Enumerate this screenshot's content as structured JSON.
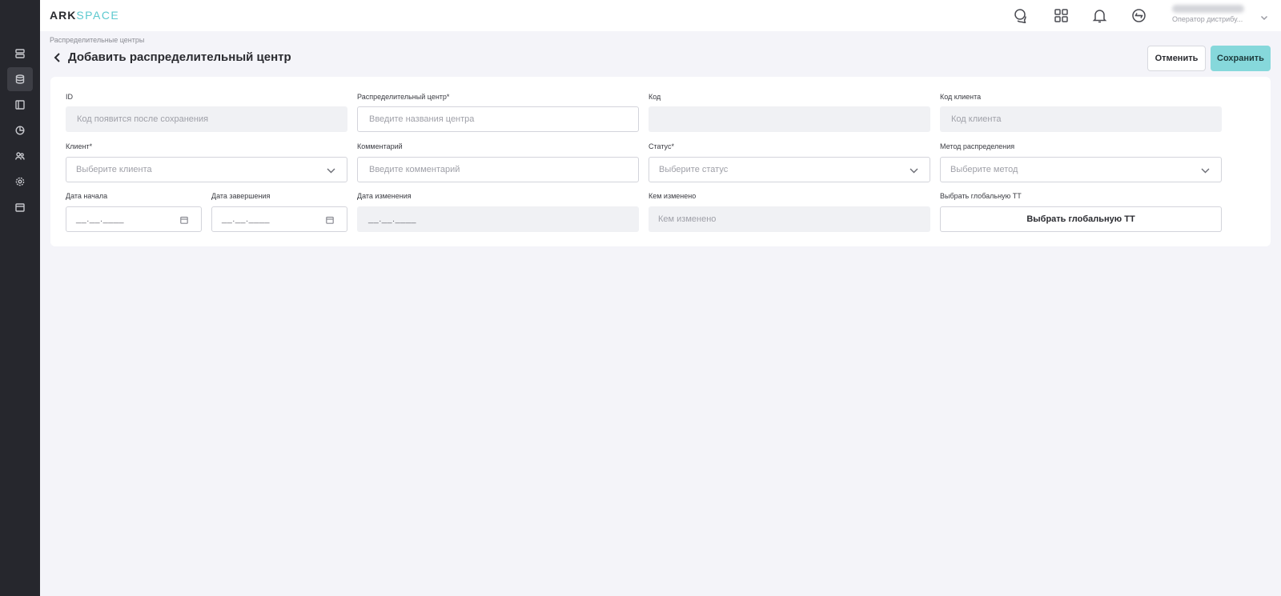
{
  "app": {
    "logo_ark": "ARK",
    "logo_space": "SPACE"
  },
  "sidebar": {
    "items": [
      {
        "icon": "server-icon",
        "active": false
      },
      {
        "icon": "database-icon",
        "active": true
      },
      {
        "icon": "layout-icon",
        "active": false
      },
      {
        "icon": "pie-chart-icon",
        "active": false
      },
      {
        "icon": "users-icon",
        "active": false
      },
      {
        "icon": "settings-icon",
        "active": false
      },
      {
        "icon": "calendar-icon",
        "active": false
      }
    ]
  },
  "header": {
    "icons": [
      "chat-icon",
      "apps-grid-icon",
      "bell-icon",
      "sync-icon"
    ],
    "user_role": "Оператор дистрибу..."
  },
  "page": {
    "breadcrumb": "Распределительные центры",
    "title": "Добавить распределительный центр",
    "cancel_label": "Отменить",
    "save_label": "Сохранить"
  },
  "form": {
    "id": {
      "label": "ID",
      "placeholder": "Код появится после сохранения"
    },
    "center": {
      "label": "Распределительный центр*",
      "placeholder": "Введите названия центра"
    },
    "code": {
      "label": "Код",
      "placeholder": ""
    },
    "client_code": {
      "label": "Код клиента",
      "placeholder": "Код клиента"
    },
    "client": {
      "label": "Клиент*",
      "placeholder": "Выберите клиента"
    },
    "comment": {
      "label": "Комментарий",
      "placeholder": "Введите комментарий"
    },
    "status": {
      "label": "Статус*",
      "placeholder": "Выберите статус"
    },
    "method": {
      "label": "Метод распределения",
      "placeholder": "Выберите метод"
    },
    "start_date": {
      "label": "Дата начала",
      "mask": "__.__.____"
    },
    "end_date": {
      "label": "Дата завершения",
      "mask": "__.__.____"
    },
    "changed_date": {
      "label": "Дата изменения",
      "mask": "__.__.____"
    },
    "changed_by": {
      "label": "Кем изменено",
      "placeholder": "Кем изменено"
    },
    "global_tt": {
      "label": "Выбрать глобальную ТТ",
      "button": "Выбрать глобальную ТТ"
    }
  },
  "colors": {
    "sidebar_bg": "#26272d",
    "accent": "#86d8db",
    "logo_accent": "#5cc9cf",
    "page_bg": "#f4f4f9"
  }
}
